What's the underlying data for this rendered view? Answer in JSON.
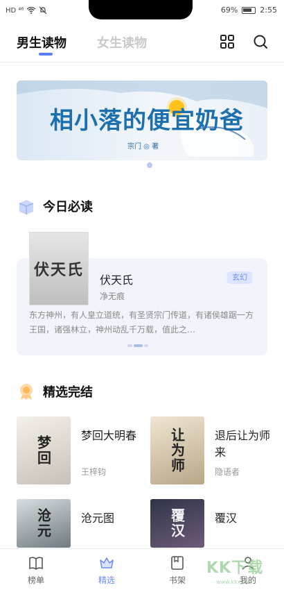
{
  "status_bar": {
    "left_text": "HD ⁴⁶",
    "battery": "69%",
    "time": "2:55"
  },
  "header": {
    "tabs": [
      {
        "label": "男生读物",
        "active": true
      },
      {
        "label": "女生读物",
        "active": false
      }
    ],
    "icons": [
      "grid-icon",
      "search-icon"
    ]
  },
  "banner": {
    "title": "相小落的便宜奶爸",
    "author_line": "宗门 ◎ 著",
    "page_dots": 1
  },
  "today": {
    "section_title": "今日必读",
    "book": {
      "cover_text": "伏天氏",
      "title": "伏天氏",
      "author": "净无痕",
      "genre": "玄幻",
      "description": "东方神州，有人皇立道统，有圣贤宗门传道，有诸侯雄踞一方王国，诸强林立，神州动乱千万载，值此之…"
    }
  },
  "finished": {
    "section_title": "精选完结",
    "books": [
      {
        "cover_text": "梦回",
        "title": "梦回大明春",
        "author": "王梓钧"
      },
      {
        "cover_text": "让为师",
        "title": "退后让为师来",
        "author": "隐语者"
      },
      {
        "cover_text": "沧元",
        "title": "沧元图",
        "author": ""
      },
      {
        "cover_text": "覆汉",
        "title": "覆汉",
        "author": ""
      }
    ]
  },
  "bottom_nav": {
    "items": [
      {
        "label": "榜单",
        "icon": "book-icon",
        "active": false
      },
      {
        "label": "精选",
        "icon": "crown-icon",
        "active": true
      },
      {
        "label": "书架",
        "icon": "bookshelf-icon",
        "active": false
      },
      {
        "label": "我的",
        "icon": "profile-icon",
        "active": false
      }
    ]
  },
  "watermark": {
    "text": "KK下载",
    "url": "www.kkx.net"
  },
  "colors": {
    "accent": "#6f8cf0",
    "tab_inactive": "#c8c8c8",
    "card_bg": "#f2f4fb"
  }
}
